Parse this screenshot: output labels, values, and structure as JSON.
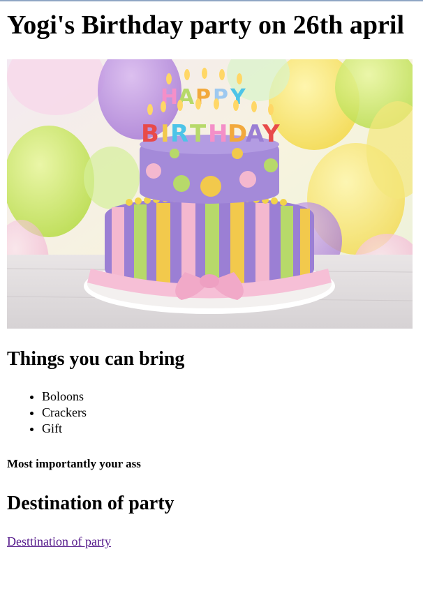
{
  "page": {
    "title": "Yogi's Birthday party on 26th april",
    "image_candle_letters": [
      "H",
      "A",
      "P",
      "P",
      "Y",
      "B",
      "I",
      "R",
      "T",
      "H",
      "D",
      "A",
      "Y"
    ]
  },
  "bring_section": {
    "heading": "Things you can bring",
    "items": [
      "Boloons",
      "Crackers",
      "Gift"
    ],
    "note": "Most importantly your ass"
  },
  "destination_section": {
    "heading": "Destination of party",
    "link_text": "Desttination of party"
  },
  "colors": {
    "link_visited": "#551a8b",
    "cake_purple": "#9b7fd4",
    "cake_pink": "#f4b8cf",
    "cake_green": "#b7d96a",
    "cake_yellow": "#f2c94c"
  }
}
